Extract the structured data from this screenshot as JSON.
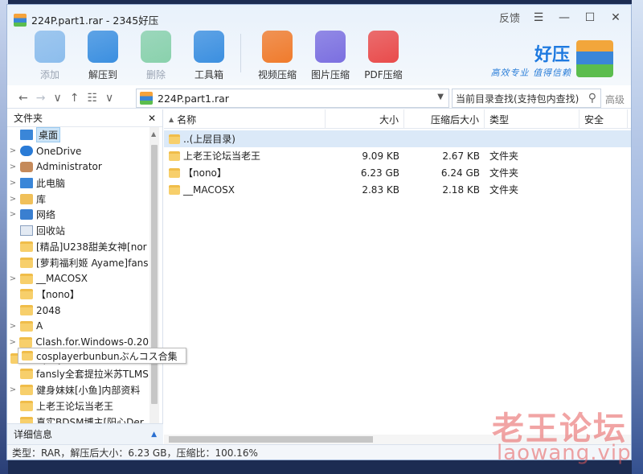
{
  "window": {
    "title": "224P.part1.rar - 2345好压",
    "feedback": "反馈"
  },
  "toolbar": [
    {
      "label": "添加",
      "icon": "add-icon",
      "color": "#3b8fe0",
      "disabled": true
    },
    {
      "label": "解压到",
      "icon": "extract-icon",
      "color": "#3b8fe0",
      "disabled": false
    },
    {
      "label": "删除",
      "icon": "delete-icon",
      "color": "#35b36b",
      "disabled": true
    },
    {
      "label": "工具箱",
      "icon": "toolbox-icon",
      "color": "#3b8fe0",
      "disabled": false
    },
    {
      "label": "视频压缩",
      "icon": "video-compress-icon",
      "color": "#f07b2c",
      "disabled": false
    },
    {
      "label": "图片压缩",
      "icon": "image-compress-icon",
      "color": "#7b6fe0",
      "disabled": false
    },
    {
      "label": "PDF压缩",
      "icon": "pdf-compress-icon",
      "color": "#e94b4b",
      "disabled": false
    }
  ],
  "brand": {
    "name": "好压",
    "slogan": "高效专业 值得信赖"
  },
  "address": {
    "path": "224P.part1.rar",
    "search_placeholder": "当前目录查找(支持包内查找)",
    "advanced": "高级"
  },
  "sidebar": {
    "title": "文件夹",
    "items": [
      {
        "label": "桌面",
        "exp": "",
        "icon": "desktop",
        "selected": true
      },
      {
        "label": "OneDrive",
        "exp": ">",
        "icon": "cloud"
      },
      {
        "label": "Administrator",
        "exp": ">",
        "icon": "user"
      },
      {
        "label": "此电脑",
        "exp": ">",
        "icon": "pc"
      },
      {
        "label": "库",
        "exp": ">",
        "icon": "library"
      },
      {
        "label": "网络",
        "exp": ">",
        "icon": "network"
      },
      {
        "label": "回收站",
        "exp": "",
        "icon": "recycle"
      },
      {
        "label": "[精品]U238甜美女神[nor",
        "exp": "",
        "icon": "folder"
      },
      {
        "label": "[萝莉福利姬 Ayame]fans",
        "exp": "",
        "icon": "folder"
      },
      {
        "label": "__MACOSX",
        "exp": ">",
        "icon": "folder"
      },
      {
        "label": "【nono】",
        "exp": "",
        "icon": "folder"
      },
      {
        "label": "2048",
        "exp": "",
        "icon": "folder"
      },
      {
        "label": "A",
        "exp": ">",
        "icon": "folder"
      },
      {
        "label": "Clash.for.Windows-0.20",
        "exp": ">",
        "icon": "folder"
      },
      {
        "label": "cosplayerbunbunぶんコス",
        "exp": "",
        "icon": "folder"
      },
      {
        "label": "fansly全套提拉米苏TLMS",
        "exp": "",
        "icon": "folder"
      },
      {
        "label": "健身妹妹[小鱼]内部资料",
        "exp": ">",
        "icon": "folder"
      },
      {
        "label": "上老王论坛当老王",
        "exp": "",
        "icon": "folder"
      },
      {
        "label": "真实BDSM博主[阳心Der",
        "exp": "",
        "icon": "folder"
      }
    ],
    "tooltip": "cosplayerbunbunぶんコス合集",
    "detail_label": "详细信息"
  },
  "columns": {
    "name": "名称",
    "size": "大小",
    "packed": "压缩后大小",
    "type": "类型",
    "security": "安全"
  },
  "files": [
    {
      "name": "..(上层目录)",
      "size": "",
      "packed": "",
      "type": "",
      "highlight": true
    },
    {
      "name": "上老王论坛当老王",
      "size": "9.09 KB",
      "packed": "2.67 KB",
      "type": "文件夹"
    },
    {
      "name": "【nono】",
      "size": "6.23 GB",
      "packed": "6.24 GB",
      "type": "文件夹"
    },
    {
      "name": "__MACOSX",
      "size": "2.83 KB",
      "packed": "2.18 KB",
      "type": "文件夹"
    }
  ],
  "status": "类型：RAR，解压后大小：6.23 GB，压缩比：100.16%",
  "watermark": {
    "cn": "老王论坛",
    "url": "laowang.vip"
  }
}
